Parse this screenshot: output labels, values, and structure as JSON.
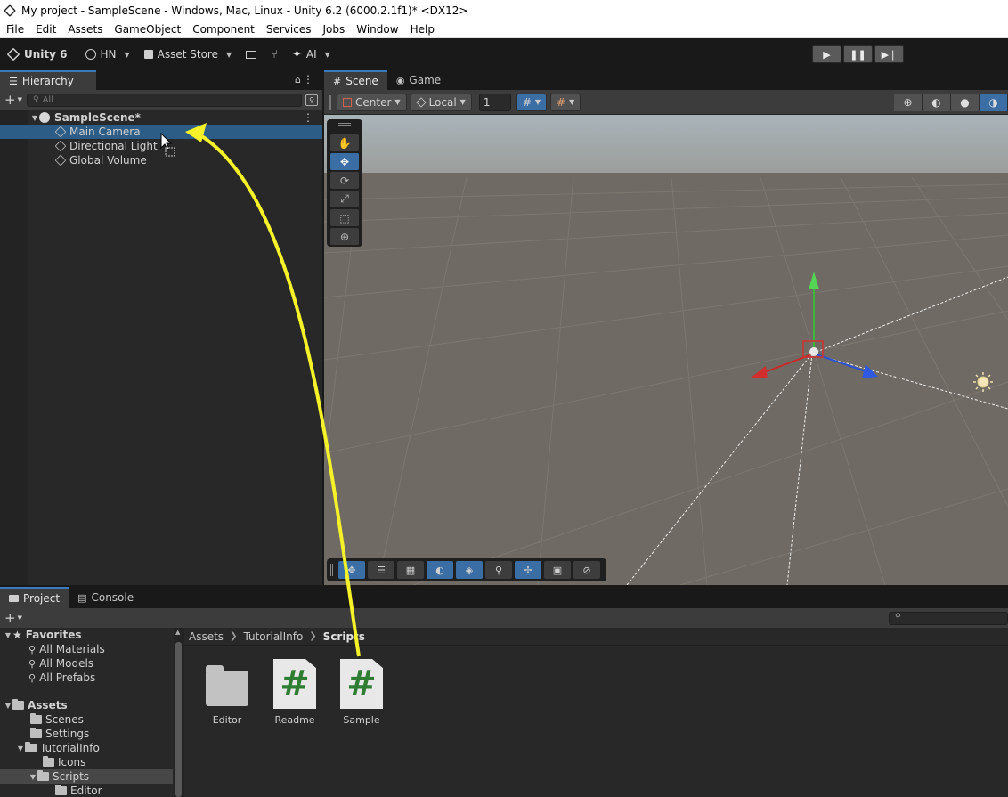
{
  "window": {
    "title": "My project - SampleScene - Windows, Mac, Linux - Unity 6.2 (6000.2.1f1)* <DX12>"
  },
  "menu": [
    "File",
    "Edit",
    "Assets",
    "GameObject",
    "Component",
    "Services",
    "Jobs",
    "Window",
    "Help"
  ],
  "toolbar": {
    "unity_label": "Unity 6",
    "account": "HN",
    "asset_store": "Asset Store",
    "ai": "AI"
  },
  "hierarchy": {
    "tab": "Hierarchy",
    "search_placeholder": "All",
    "scene": "SampleScene*",
    "items": [
      "Main Camera",
      "Directional Light",
      "Global Volume"
    ],
    "selected": "Main Camera"
  },
  "scene_view": {
    "tabs": [
      "Scene",
      "Game"
    ],
    "pivot": "Center",
    "space": "Local",
    "snap_value": "1"
  },
  "project": {
    "tabs": [
      "Project",
      "Console"
    ],
    "favorites": {
      "label": "Favorites",
      "items": [
        "All Materials",
        "All Models",
        "All Prefabs"
      ]
    },
    "tree": {
      "assets": "Assets",
      "scenes": "Scenes",
      "settings": "Settings",
      "tutorialinfo": "TutorialInfo",
      "icons": "Icons",
      "scripts": "Scripts",
      "editor": "Editor"
    },
    "breadcrumb": [
      "Assets",
      "TutorialInfo",
      "Scripts"
    ],
    "files": [
      {
        "name": "Editor",
        "kind": "folder"
      },
      {
        "name": "Readme",
        "kind": "script"
      },
      {
        "name": "Sample",
        "kind": "script"
      }
    ]
  },
  "colors": {
    "annotation_arrow": "#f5f22a",
    "selection": "#2c5d87",
    "accent": "#3a6ea5"
  }
}
